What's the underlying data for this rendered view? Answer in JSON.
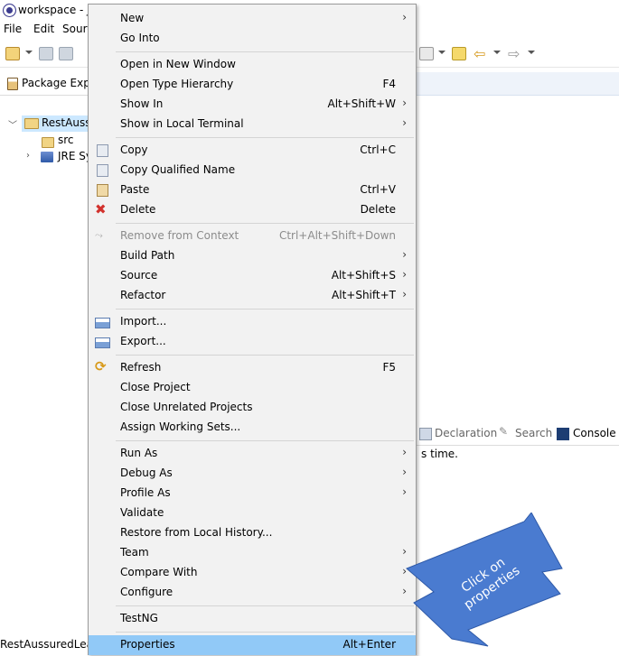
{
  "window": {
    "title": "workspace - Ja"
  },
  "menubar": {
    "items": [
      {
        "label": "File",
        "underline": "F"
      },
      {
        "label": "Edit",
        "underline": "E"
      },
      {
        "label": "Sourc",
        "underline": "S"
      }
    ]
  },
  "package_explorer": {
    "tab_label": "Package Explo",
    "tree": [
      {
        "label": "RestAussu",
        "expanded": true,
        "icon": "project-folder-icon"
      },
      {
        "label": "src",
        "icon": "package-folder-icon"
      },
      {
        "label": "JRE Sy",
        "icon": "jre-library-icon"
      }
    ]
  },
  "bottom_panel": {
    "tabs": [
      {
        "label": "Declaration",
        "icon": "declaration-icon"
      },
      {
        "label": "Search",
        "icon": "search-icon"
      },
      {
        "label": "Console",
        "icon": "console-icon"
      }
    ],
    "console_text": "s time."
  },
  "status": {
    "text": "RestAussuredLearr"
  },
  "context_menu": {
    "items": [
      {
        "label": "New",
        "submenu": true
      },
      {
        "label": "Go Into"
      },
      {
        "label": "Open in New Window"
      },
      {
        "label": "Open Type Hierarchy",
        "shortcut": "F4"
      },
      {
        "label": "Show In",
        "shortcut": "Alt+Shift+W",
        "submenu": true
      },
      {
        "label": "Show in Local Terminal",
        "submenu": true
      },
      {
        "label": "Copy",
        "shortcut": "Ctrl+C",
        "icon": "copy-icon"
      },
      {
        "label": "Copy Qualified Name",
        "icon": "copy-qualified-icon"
      },
      {
        "label": "Paste",
        "shortcut": "Ctrl+V",
        "icon": "paste-icon"
      },
      {
        "label": "Delete",
        "shortcut": "Delete",
        "icon": "delete-icon"
      },
      {
        "label": "Remove from Context",
        "shortcut": "Ctrl+Alt+Shift+Down",
        "disabled": true,
        "icon": "remove-context-icon"
      },
      {
        "label": "Build Path",
        "submenu": true
      },
      {
        "label": "Source",
        "shortcut": "Alt+Shift+S",
        "submenu": true
      },
      {
        "label": "Refactor",
        "shortcut": "Alt+Shift+T",
        "submenu": true
      },
      {
        "label": "Import...",
        "icon": "import-icon"
      },
      {
        "label": "Export...",
        "icon": "export-icon"
      },
      {
        "label": "Refresh",
        "shortcut": "F5",
        "icon": "refresh-icon"
      },
      {
        "label": "Close Project"
      },
      {
        "label": "Close Unrelated Projects"
      },
      {
        "label": "Assign Working Sets..."
      },
      {
        "label": "Run As",
        "submenu": true
      },
      {
        "label": "Debug As",
        "submenu": true
      },
      {
        "label": "Profile As",
        "submenu": true
      },
      {
        "label": "Validate"
      },
      {
        "label": "Restore from Local History..."
      },
      {
        "label": "Team",
        "submenu": true
      },
      {
        "label": "Compare With",
        "submenu": true
      },
      {
        "label": "Configure",
        "submenu": true
      },
      {
        "label": "TestNG"
      },
      {
        "label": "Properties",
        "shortcut": "Alt+Enter",
        "highlighted": true
      }
    ]
  },
  "annotation": {
    "text": "Click on properties",
    "color": "#4a7bd0"
  }
}
